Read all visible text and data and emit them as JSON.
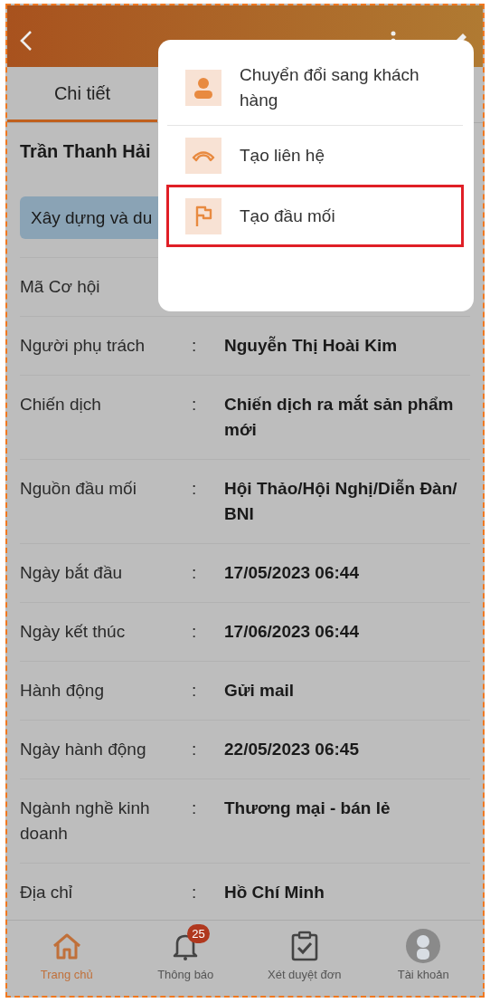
{
  "tabs": [
    {
      "label": "Chi tiết",
      "selected": true
    }
  ],
  "opportunity": {
    "name": "Trần Thanh Hải",
    "tag": "Xây dựng và du"
  },
  "fields": [
    {
      "label": "Mã Cơ hội"
    },
    {
      "label": "Người phụ trách",
      "colon": ":",
      "value": "Nguyễn Thị Hoài Kim"
    },
    {
      "label": "Chiến dịch",
      "colon": ":",
      "value": "Chiến dịch ra mắt sản phẩm mới"
    },
    {
      "label": "Nguồn đầu mối",
      "colon": ":",
      "value": "Hội Thảo/Hội Nghị/Diễn Đàn/ BNI"
    },
    {
      "label": "Ngày bắt đầu",
      "colon": ":",
      "value": "17/05/2023 06:44"
    },
    {
      "label": "Ngày kết thúc",
      "colon": ":",
      "value": "17/06/2023 06:44"
    },
    {
      "label": "Hành động",
      "colon": ":",
      "value": "Gửi mail"
    },
    {
      "label": "Ngày hành động",
      "colon": ":",
      "value": "22/05/2023 06:45"
    },
    {
      "label": "Ngành nghề kinh doanh",
      "colon": ":",
      "value": "Thương mại - bán lẻ"
    },
    {
      "label": "Địa chỉ",
      "colon": ":",
      "value": "Hồ Chí Minh"
    }
  ],
  "menu": {
    "items": [
      {
        "kind": "person",
        "label": "Chuyển đổi sang khách hàng",
        "highlighted": false
      },
      {
        "kind": "phone",
        "label": "Tạo liên hệ",
        "highlighted": false
      },
      {
        "kind": "flag",
        "label": "Tạo đầu mối",
        "highlighted": true
      }
    ]
  },
  "nav": [
    {
      "kind": "home",
      "label": "Trang chủ",
      "selected": true
    },
    {
      "kind": "bell",
      "label": "Thông báo",
      "badge": "25",
      "selected": false
    },
    {
      "kind": "approve",
      "label": "Xét duyệt đơn",
      "selected": false
    },
    {
      "kind": "account",
      "label": "Tài khoản",
      "selected": false
    }
  ]
}
